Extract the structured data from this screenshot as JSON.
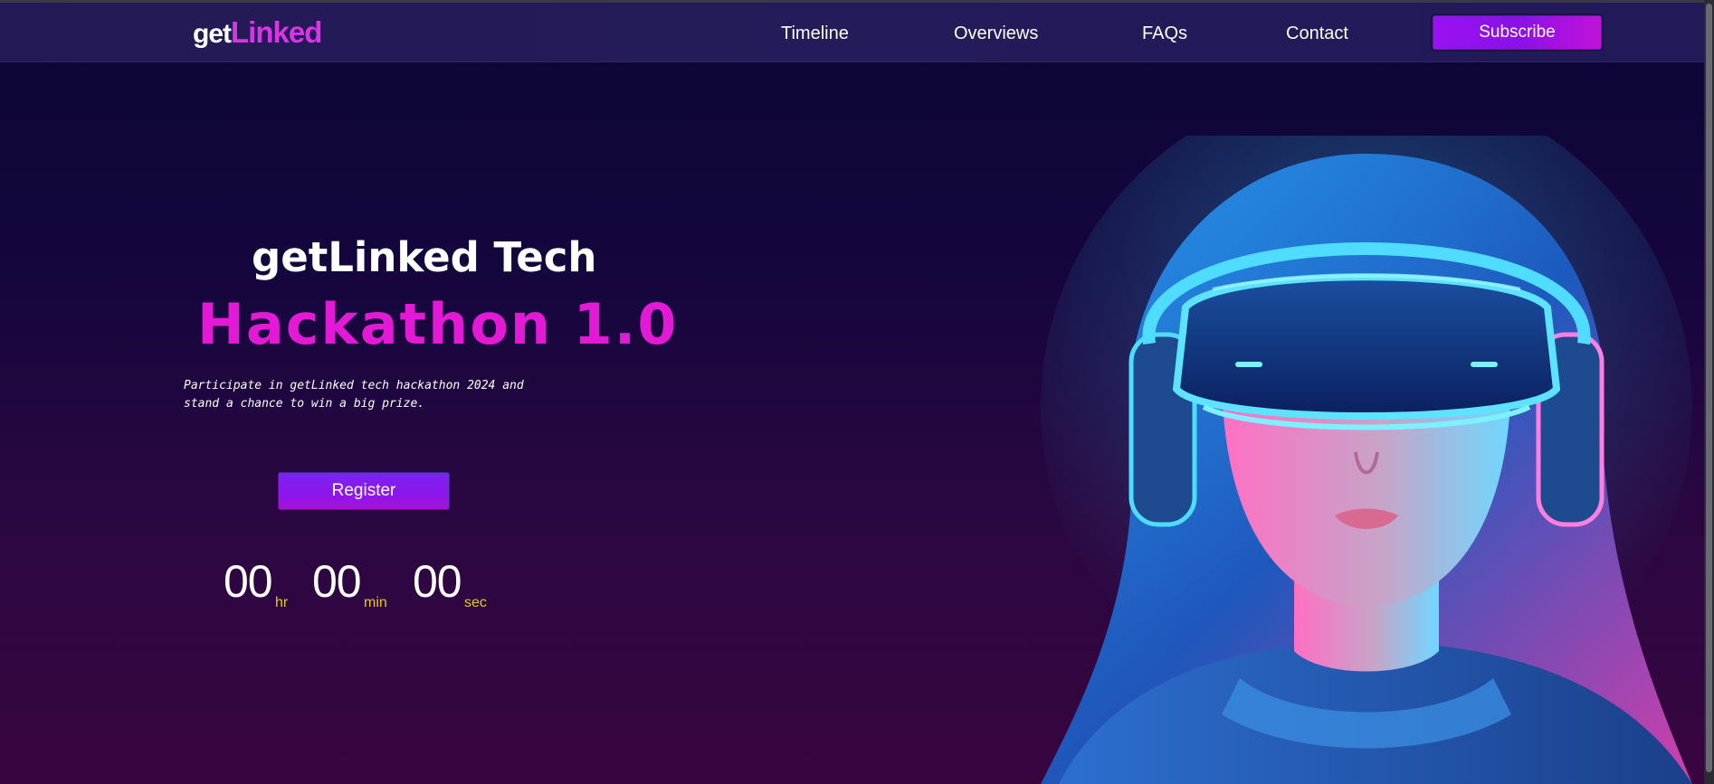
{
  "header": {
    "logo": {
      "get": "get",
      "linked": "Linked"
    },
    "nav": [
      {
        "label": "Timeline"
      },
      {
        "label": "Overviews"
      },
      {
        "label": "FAQs"
      },
      {
        "label": "Contact"
      }
    ],
    "subscribe_label": "Subscribe"
  },
  "hero": {
    "title_line1": "getLinked Tech",
    "title_line2": "Hackathon 1.0",
    "description": "Participate in getLinked tech hackathon 2024 and stand a chance to win a big prize.",
    "register_label": "Register",
    "countdown": {
      "hours": "00",
      "hours_unit": "hr",
      "minutes": "00",
      "minutes_unit": "min",
      "seconds": "00",
      "seconds_unit": "sec"
    }
  },
  "colors": {
    "accent_pink": "#e21ad6",
    "accent_purple": "#9b11f2",
    "countdown_unit": "#e8c81a",
    "header_bg": "#231a55"
  }
}
